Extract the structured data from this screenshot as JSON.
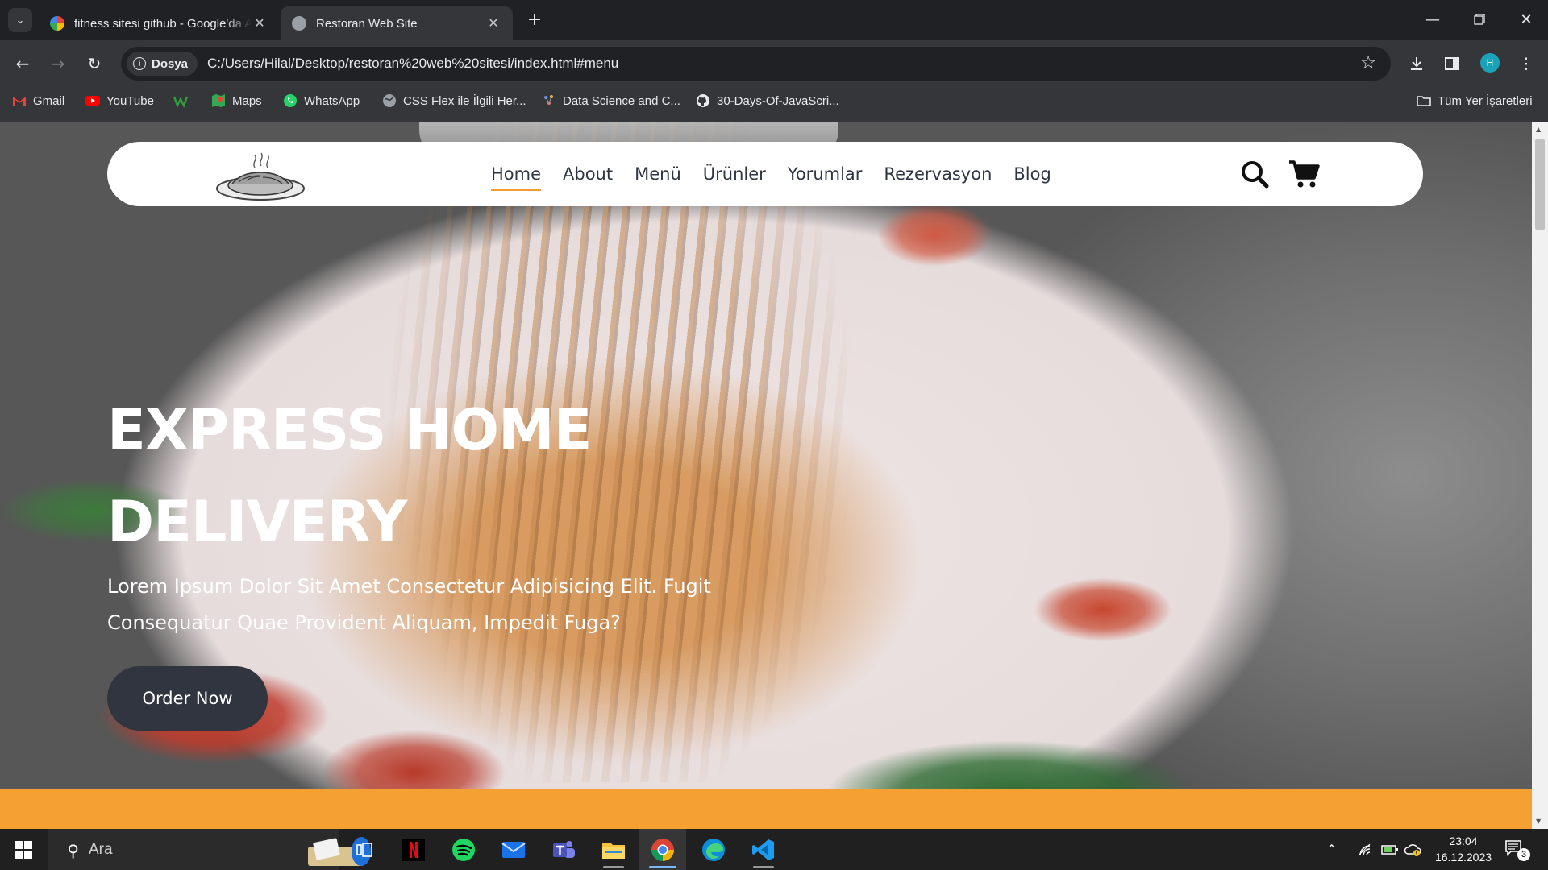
{
  "browser": {
    "tabs": [
      {
        "title": "fitness sitesi github - Google'da Ara",
        "favicon": "google-g-icon",
        "active": false
      },
      {
        "title": "Restoran Web Site",
        "favicon": "globe-icon",
        "active": true
      }
    ],
    "site_chip_label": "Dosya",
    "url": "C:/Users/Hilal/Desktop/restoran%20web%20sitesi/index.html#menu",
    "profile_initial": "H",
    "bookmarks": [
      {
        "label": "Gmail",
        "icon": "gmail-icon",
        "color": "#ea4335"
      },
      {
        "label": "YouTube",
        "icon": "youtube-icon",
        "color": "#ff0000"
      },
      {
        "label": "",
        "icon": "w-icon",
        "color": "#2e9e3f"
      },
      {
        "label": "Maps",
        "icon": "maps-icon",
        "color": "#34a853"
      },
      {
        "label": "WhatsApp",
        "icon": "whatsapp-icon",
        "color": "#25d366"
      },
      {
        "label": "CSS Flex ile İlgili Her...",
        "icon": "globe-icon",
        "color": "#9aa0a6"
      },
      {
        "label": "Data Science and C...",
        "icon": "data-science-icon",
        "color": "#6b8cff"
      },
      {
        "label": "30-Days-Of-JavaScri...",
        "icon": "github-icon",
        "color": "#e8eaed"
      }
    ],
    "all_bookmarks_label": "Tüm Yer İşaretleri"
  },
  "site": {
    "nav_items": [
      "Home",
      "About",
      "Menü",
      "Ürünler",
      "Yorumlar",
      "Rezervasyon",
      "Blog"
    ],
    "active_nav": "Home",
    "hero_title_line1": "EXPRESS HOME",
    "hero_title_line2": "DELIVERY",
    "hero_subtitle_line1": "Lorem Ipsum Dolor Sit Amet Consectetur Adipisicing Elit. Fugit",
    "hero_subtitle_line2": "Consequatur Quae Provident Aliquam, Impedit Fuga?",
    "cta_label": "Order Now",
    "colors": {
      "accent": "#f5a032",
      "button": "#303540",
      "nav_text": "#2f3542"
    }
  },
  "taskbar": {
    "search_label": "Ara",
    "apps": [
      {
        "name": "task-view",
        "icon": "task-view-icon"
      },
      {
        "name": "netflix",
        "icon": "netflix-icon"
      },
      {
        "name": "spotify",
        "icon": "spotify-icon"
      },
      {
        "name": "mail",
        "icon": "mail-icon"
      },
      {
        "name": "teams",
        "icon": "teams-icon"
      },
      {
        "name": "file-explorer",
        "icon": "folder-icon"
      },
      {
        "name": "chrome",
        "icon": "chrome-icon"
      },
      {
        "name": "edge",
        "icon": "edge-icon"
      },
      {
        "name": "vscode",
        "icon": "vscode-icon"
      }
    ],
    "time": "23:04",
    "date": "16.12.2023",
    "notification_count": "3"
  }
}
